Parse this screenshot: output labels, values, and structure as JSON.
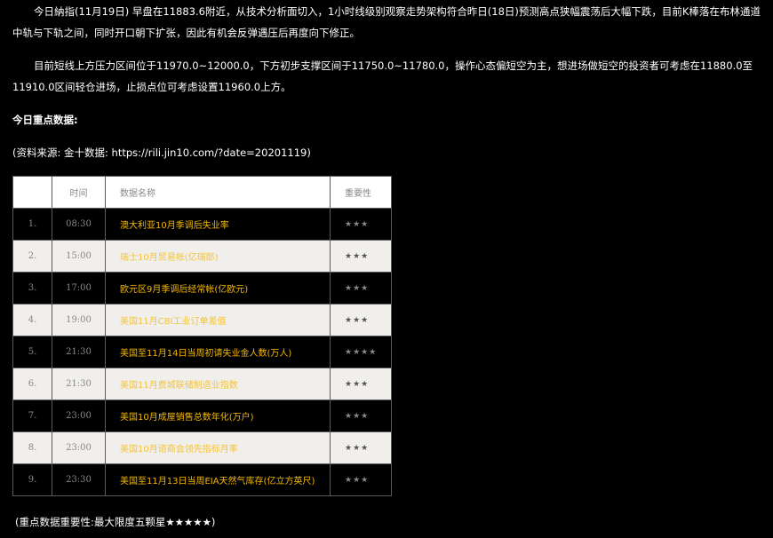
{
  "paragraphs": {
    "p1": "今日納指(11月19日) 早盘在11883.6附近，从技术分析面切入，1小时线级别观察走势架构符合昨日(18日)预测高点狭幅震荡后大幅下跌，目前K棒落在布林通道中轨与下轨之间，同时开口朝下扩张，因此有机会反弹遇压后再度向下修正。",
    "p2": "目前短线上方压力区间位于11970.0~12000.0，下方初步支撑区间于11750.0~11780.0，操作心态偏短空为主，想进场做短空的投资者可考虑在11880.0至11910.0区间轻仓进场，止损点位可考虑设置11960.0上方。",
    "p3": "今日重点数据:",
    "p4": "(资料来源: 金十数据: https://rili.jin10.com/?date=20201119)",
    "footer": "(重点数据重要性:最大限度五颗星★★★★★)"
  },
  "table": {
    "headers": {
      "no": "",
      "time": "时间",
      "name": "数据名称",
      "importance": "重要性"
    },
    "rows": [
      {
        "no": "1.",
        "time": "08:30",
        "name": "澳大利亚10月季调后失业率",
        "importance": "★★★"
      },
      {
        "no": "2.",
        "time": "15:00",
        "name": "瑞士10月贸易帐(亿瑞郎)",
        "importance": "★★★"
      },
      {
        "no": "3.",
        "time": "17:00",
        "name": "欧元区9月季调后经常帐(亿欧元)",
        "importance": "★★★"
      },
      {
        "no": "4.",
        "time": "19:00",
        "name": "美国11月CBI工业订单差值",
        "importance": "★★★"
      },
      {
        "no": "5.",
        "time": "21:30",
        "name": "美国至11月14日当周初请失业金人数(万人)",
        "importance": "★★★★"
      },
      {
        "no": "6.",
        "time": "21:30",
        "name": "美国11月费城联储制造业指数",
        "importance": "★★★"
      },
      {
        "no": "7.",
        "time": "23:00",
        "name": "美国10月成屋销售总数年化(万户)",
        "importance": "★★★"
      },
      {
        "no": "8.",
        "time": "23:00",
        "name": "美国10月谘商会领先指标月率",
        "importance": "★★★"
      },
      {
        "no": "9.",
        "time": "23:30",
        "name": "美国至11月13日当周EIA天然气库存(亿立方英尺)",
        "importance": "★★★"
      }
    ]
  },
  "colors": {
    "background": "#000000",
    "text": "#ffffff",
    "highlight": "#f5b800",
    "row_dark": "#000000",
    "row_light": "#f0efeb"
  }
}
